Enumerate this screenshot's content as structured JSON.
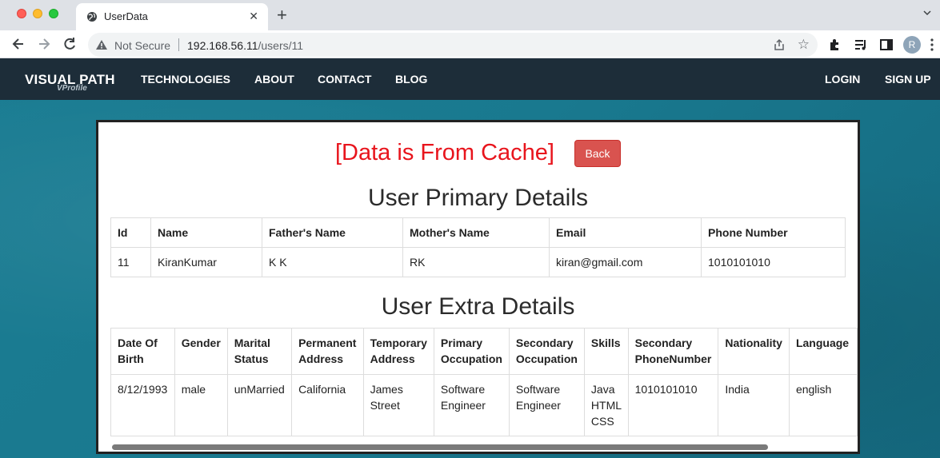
{
  "browser": {
    "tab_title": "UserData",
    "security_label": "Not Secure",
    "url_host": "192.168.56.11",
    "url_path": "/users/11",
    "profile_initial": "R"
  },
  "navbar": {
    "brand": "VISUAL PATH",
    "brand_sub": "VProfile",
    "links": [
      "TECHNOLOGIES",
      "ABOUT",
      "CONTACT",
      "BLOG"
    ],
    "login": "LOGIN",
    "signup": "SIGN UP"
  },
  "content": {
    "cache_message": "[Data is From Cache]",
    "back_label": "Back",
    "primary_title": "User Primary Details",
    "extra_title": "User Extra Details"
  },
  "primary_table": {
    "headers": [
      "Id",
      "Name",
      "Father's Name",
      "Mother's Name",
      "Email",
      "Phone Number"
    ],
    "row": [
      "11",
      "KiranKumar",
      "K K",
      "RK",
      "kiran@gmail.com",
      "1010101010"
    ]
  },
  "extra_table": {
    "headers": [
      "Date Of Birth",
      "Gender",
      "Marital Status",
      "Permanent Address",
      "Temporary Address",
      "Primary Occupation",
      "Secondary Occupation",
      "Skills",
      "Secondary PhoneNumber",
      "Nationality",
      "Language"
    ],
    "row": [
      "8/12/1993",
      "male",
      "unMarried",
      "California",
      "James Street",
      "Software Engineer",
      "Software Engineer",
      "Java HTML CSS",
      "1010101010",
      "India",
      "english"
    ]
  },
  "colors": {
    "cache_text": "#e8141c",
    "back_button": "#d9534f",
    "navbar_bg": "#1d2d39",
    "page_bg": "#1b7d93"
  }
}
